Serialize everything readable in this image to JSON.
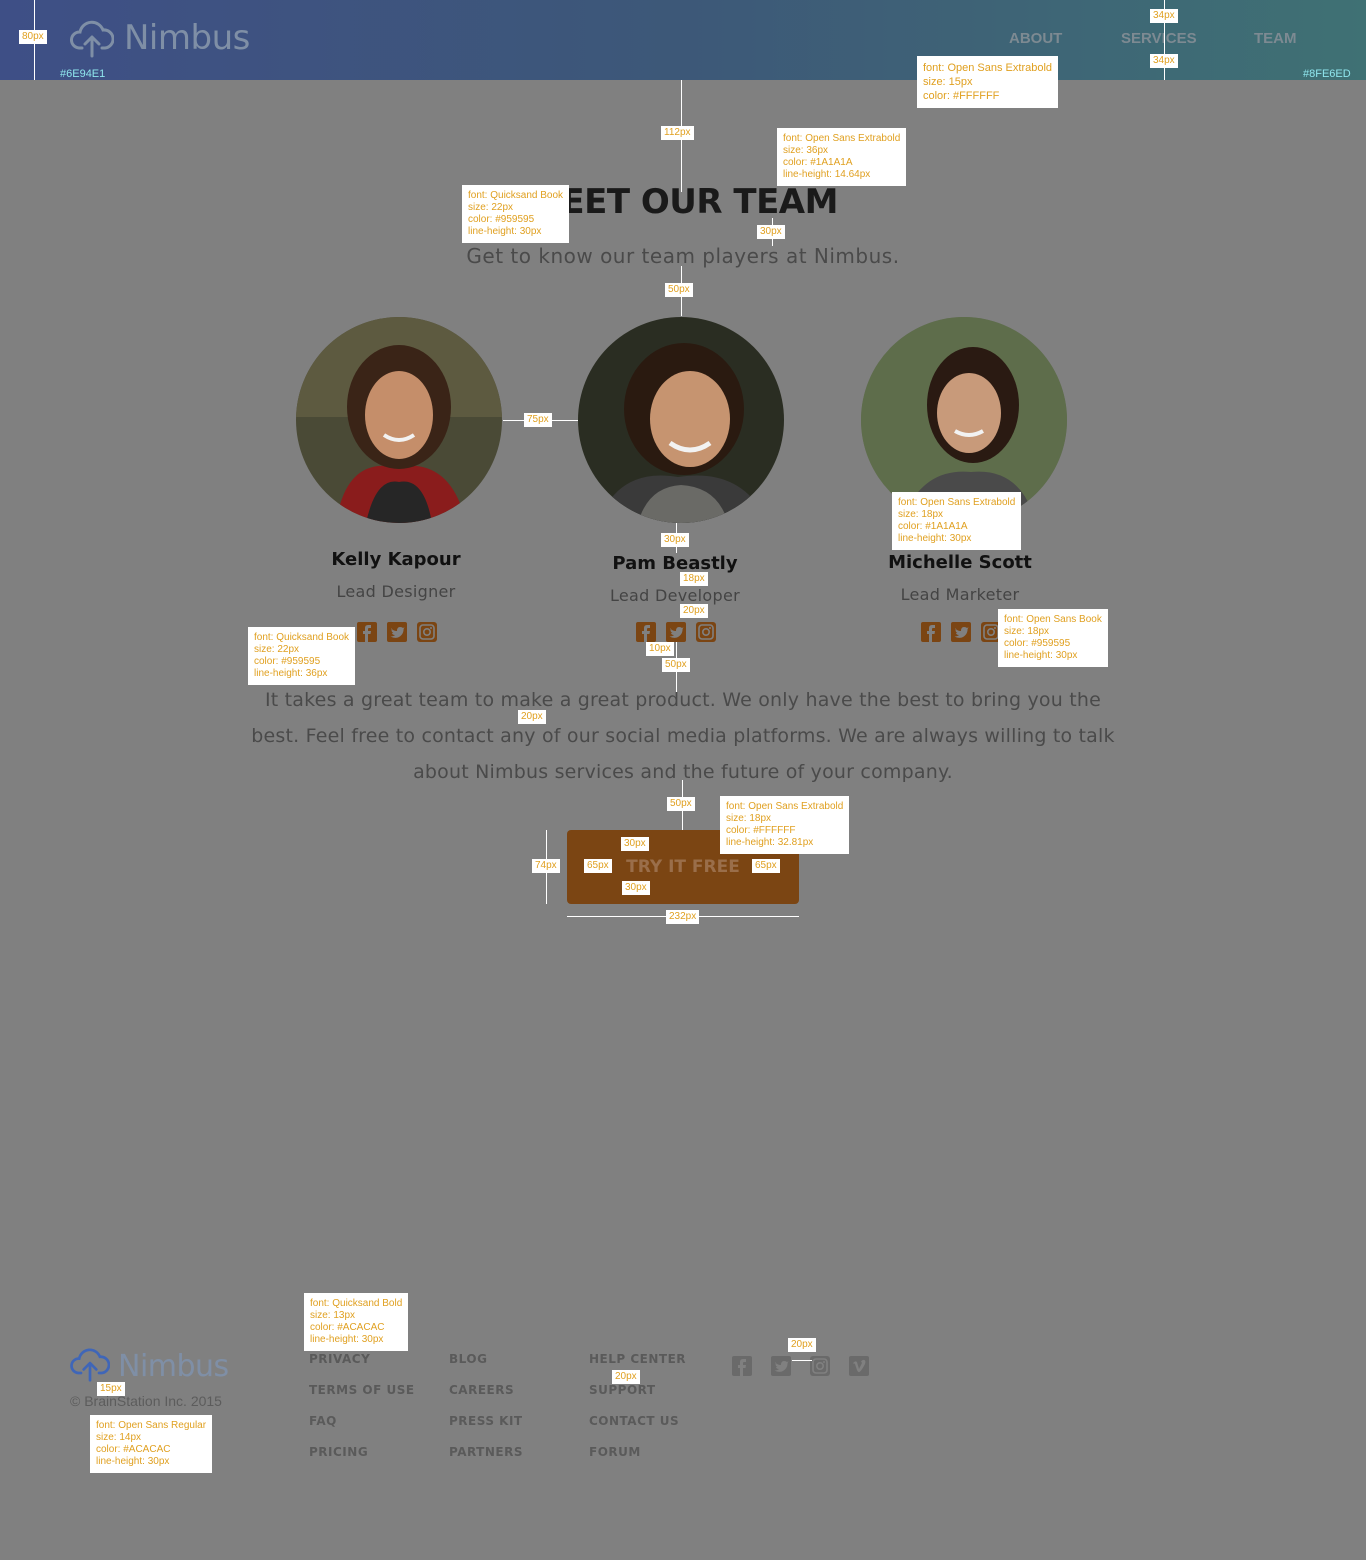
{
  "header": {
    "logo_text": "Nimbus",
    "nav": [
      "ABOUT",
      "SERVICES",
      "TEAM"
    ],
    "color_left": "#6E94E1",
    "color_right": "#8FE6ED"
  },
  "annotations": {
    "nav_font": "font: Open Sans Extrabold\nsize: 15px\ncolor: #FFFFFF",
    "title_font": "font: Open Sans Extrabold\nsize: 36px\ncolor: #1A1A1A\nline-height: 14.64px",
    "subtitle_font": "font: Quicksand Book\nsize: 22px\ncolor: #959595\nline-height: 30px",
    "name_font": "font: Open Sans Extrabold\nsize: 18px\ncolor: #1A1A1A\nline-height: 30px",
    "role_font": "font: Open Sans Book\nsize: 18px\ncolor: #959595\nline-height: 30px",
    "para_font": "font: Quicksand Book\nsize: 22px\ncolor: #959595\nline-height: 36px",
    "cta_font": "font: Open Sans Extrabold\nsize: 18px\ncolor: #FFFFFF\nline-height: 32.81px",
    "footer_link_font": "font: Quicksand Bold\nsize: 13px\ncolor: #ACACAC\nline-height: 30px",
    "copyright_font": "font: Open Sans Regular\nsize: 14px\ncolor: #ACACAC\nline-height: 30px",
    "m80": "80px",
    "m34a": "34px",
    "m34b": "34px",
    "m112": "112px",
    "m30a": "30px",
    "m50a": "50px",
    "m75": "75px",
    "m30b": "30px",
    "m18": "18px",
    "m20a": "20px",
    "m10": "10px",
    "m50b": "50px",
    "m20b": "20px",
    "m50c": "50px",
    "m30c": "30px",
    "m30d": "30px",
    "m74": "74px",
    "m65a": "65px",
    "m65b": "65px",
    "m232": "232px",
    "m20c": "20px",
    "m20d": "20px",
    "m15": "15px"
  },
  "main": {
    "title": "MEET OUR TEAM",
    "subtitle": "Get to know our team players at Nimbus.",
    "members": [
      {
        "name": "Kelly Kapour",
        "role": "Lead Designer"
      },
      {
        "name": "Pam Beastly",
        "role": "Lead Developer"
      },
      {
        "name": "Michelle Scott",
        "role": "Lead Marketer"
      }
    ],
    "paragraph": "It takes a great team to make a great product. We only have the best to bring you the best. Feel free to contact any of our social media platforms. We are always willing to talk about Nimbus services and the future of your company.",
    "cta_label": "TRY IT FREE",
    "accent": "#7B4513"
  },
  "footer": {
    "logo_text": "Nimbus",
    "copyright": "© BrainStation Inc. 2015",
    "col1": [
      "PRIVACY",
      "TERMS OF USE",
      "FAQ",
      "PRICING"
    ],
    "col2": [
      "BLOG",
      "CAREERS",
      "PRESS KIT",
      "PARTNERS"
    ],
    "col3": [
      "HELP CENTER",
      "SUPPORT",
      "CONTACT US",
      "FORUM"
    ],
    "social_icons": [
      "facebook-icon",
      "twitter-icon",
      "instagram-icon",
      "vimeo-icon"
    ]
  }
}
